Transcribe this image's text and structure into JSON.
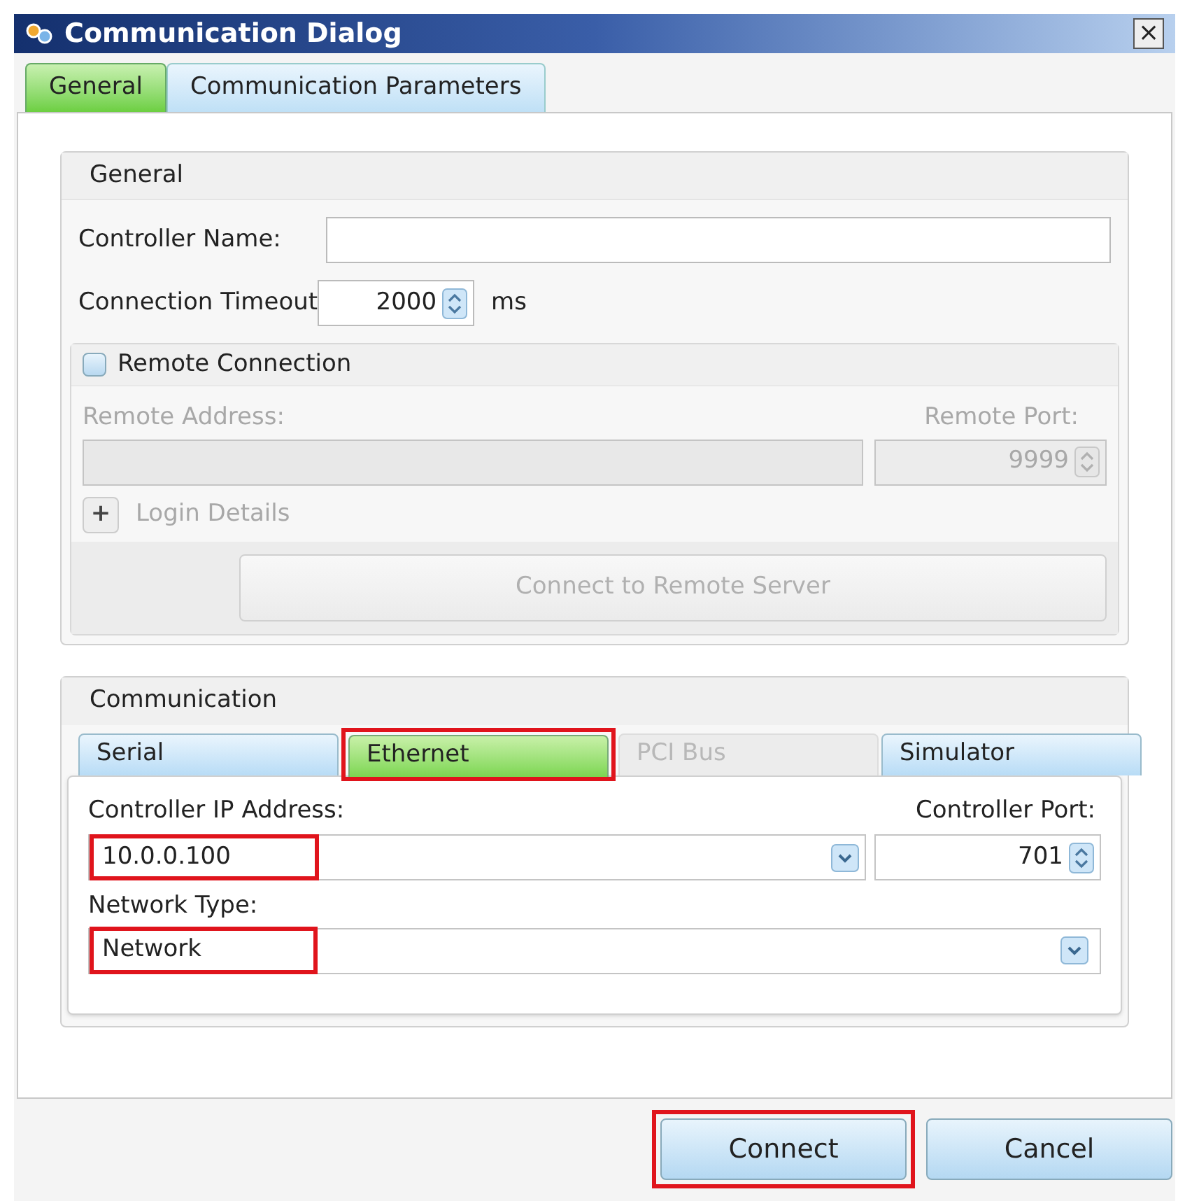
{
  "window": {
    "title": "Communication Dialog",
    "close": "×"
  },
  "tabs": [
    {
      "label": "General",
      "selected": true
    },
    {
      "label": "Communication Parameters",
      "selected": false
    }
  ],
  "general_group": {
    "title": "General",
    "controller_name": {
      "label": "Controller Name:"
    },
    "timeout": {
      "label": "Connection Timeout",
      "value": "2000",
      "unit": "ms"
    }
  },
  "remote_group": {
    "title": "Remote Connection",
    "checked": false,
    "address": {
      "label": "Remote Address:",
      "disabled": true
    },
    "port": {
      "label": "Remote Port:",
      "value": "9999",
      "disabled": true
    },
    "login": {
      "icon": "+",
      "label": "Login Details",
      "disabled": true
    },
    "connect_button": {
      "label": "Connect to Remote Server",
      "disabled": true
    }
  },
  "communication_group": {
    "title": "Communication",
    "tabs": [
      {
        "label": "Serial",
        "selected": false,
        "disabled": false
      },
      {
        "label": "Ethernet",
        "selected": true,
        "disabled": false,
        "highlighted": true
      },
      {
        "label": "PCI Bus",
        "selected": false,
        "disabled": true
      },
      {
        "label": "Simulator",
        "selected": false,
        "disabled": false
      }
    ],
    "ip": {
      "label": "Controller IP Address:",
      "value": "10.0.0.100",
      "highlighted": true
    },
    "port": {
      "label": "Controller Port:",
      "value": "701"
    },
    "network_type": {
      "label": "Network Type:",
      "value": "Network",
      "highlighted": true
    }
  },
  "buttons": [
    {
      "label": "Connect",
      "highlighted": true
    },
    {
      "label": "Cancel"
    }
  ]
}
